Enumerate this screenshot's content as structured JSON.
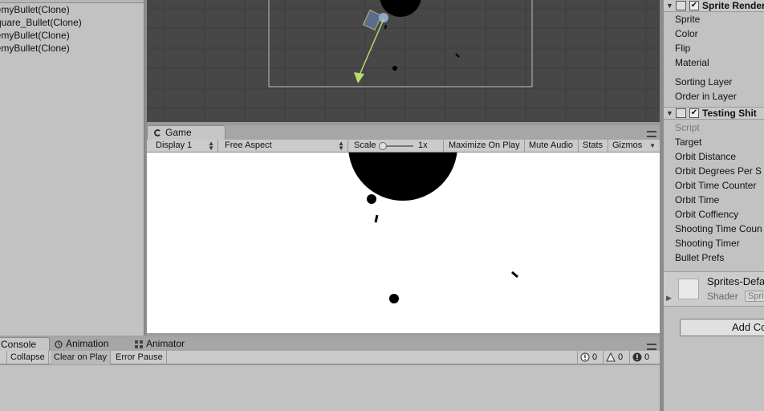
{
  "hierarchy": {
    "items": [
      {
        "label": "EnemyBullet(Clone)"
      },
      {
        "label": "Square_Bullet(Clone)"
      },
      {
        "label": "EnemyBullet(Clone)"
      },
      {
        "label": "EnemyBullet(Clone)"
      }
    ]
  },
  "game": {
    "tab_label": "Game",
    "display": "Display 1",
    "aspect": "Free Aspect",
    "scale_label": "Scale",
    "scale_value": "1x",
    "maximize_label": "Maximize On Play",
    "mute_label": "Mute Audio",
    "stats_label": "Stats",
    "gizmos_label": "Gizmos"
  },
  "console": {
    "tabs": [
      {
        "label": "Console",
        "icon": "console-icon"
      },
      {
        "label": "Animation",
        "icon": "animation-icon"
      },
      {
        "label": "Animator",
        "icon": "animator-icon"
      }
    ],
    "collapse_label": "Collapse",
    "clear_on_play_label": "Clear on Play",
    "error_pause_label": "Error Pause",
    "info_count": "0",
    "warning_count": "0",
    "error_count": "0"
  },
  "inspector": {
    "sprite_renderer": {
      "title": "Sprite Renderer",
      "enabled": true,
      "props": [
        "Sprite",
        "Color",
        "Flip",
        "Material",
        "Sorting Layer",
        "Order in Layer"
      ]
    },
    "testing_script": {
      "title": "Testing Shit",
      "enabled": true,
      "props": [
        "Script",
        "Target",
        "Orbit Distance",
        "Orbit Degrees Per S",
        "Orbit Time Counter",
        "Orbit Time",
        "Orbit Coffiency",
        "Shooting Time Coun",
        "Shooting Timer",
        "Bullet Prefs"
      ]
    },
    "material": {
      "name": "Sprites-Default",
      "shader_label": "Shader",
      "shader_value": "Sprites"
    },
    "add_component_label": "Add Component"
  },
  "colors": {
    "scene_bg": "#474747",
    "game_bg": "#ffffff",
    "gizmo_green": "#b7dc6a",
    "panel_bg": "#c2c2c2"
  }
}
